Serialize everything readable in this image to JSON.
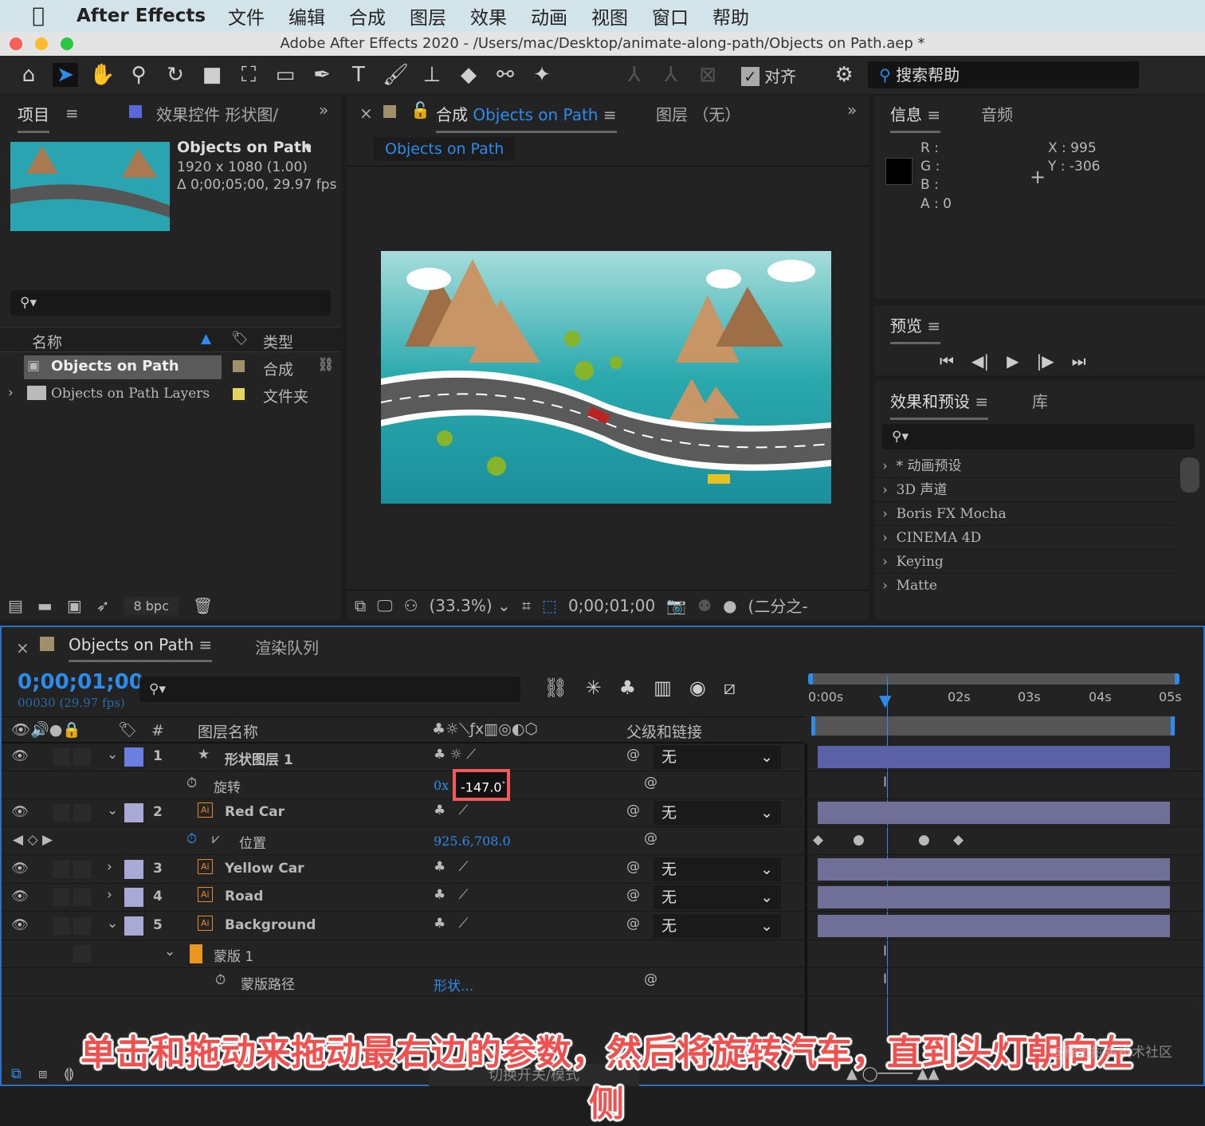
{
  "menubar": {
    "app": "After Effects",
    "items": [
      "文件",
      "编辑",
      "合成",
      "图层",
      "效果",
      "动画",
      "视图",
      "窗口",
      "帮助"
    ]
  },
  "window_title": "Adobe After Effects 2020 - /Users/mac/Desktop/animate-along-path/Objects on Path.aep *",
  "toolbar": {
    "snap_label": "对齐",
    "snap_checked": true,
    "search_help": "搜索帮助"
  },
  "project": {
    "tab": "项目",
    "effects_tab": "效果控件 形状图/",
    "comp_name": "Objects on Path",
    "comp_info1": "1920 x 1080 (1.00)",
    "comp_info2": "Δ 0;00;05;00, 29.97 fps",
    "col_name": "名称",
    "col_type": "类型",
    "items": [
      {
        "name": "Objects on Path",
        "type": "合成",
        "color": "#a0906a"
      },
      {
        "name": "Objects on Path Layers",
        "type": "文件夹",
        "color": "#e3d45a"
      }
    ],
    "bpc": "8 bpc"
  },
  "comp": {
    "tab_prefix": "合成",
    "tab_name": "Objects on Path",
    "layer_tab": "图层 （无）",
    "breadcrumb": "Objects on Path",
    "zoom": "(33.3%)",
    "timecode": "0;00;01;00",
    "resolution": "(二分之-"
  },
  "info": {
    "tab": "信息",
    "audio_tab": "音频",
    "r": "R :",
    "g": "G :",
    "b": "B :",
    "a": "A :  0",
    "x": "X : 995",
    "y": "Y :  -306"
  },
  "preview": {
    "tab": "预览"
  },
  "effects": {
    "tab": "效果和预设",
    "lib_tab": "库",
    "items": [
      "* 动画预设",
      "3D 声道",
      "Boris FX Mocha",
      "CINEMA 4D",
      "Keying",
      "Matte"
    ]
  },
  "timeline": {
    "tab": "Objects on Path",
    "render_tab": "渲染队列",
    "timecode": "0;00;01;00",
    "frames": "00030 (29.97 fps)",
    "col_hash": "#",
    "col_layer": "图层名称",
    "col_parent": "父级和链接",
    "ruler": [
      "0:00s",
      "02s",
      "03s",
      "04s",
      "05s"
    ],
    "toggle_mode": "切换开关/模式",
    "layers": [
      {
        "num": "1",
        "name": "形状图层 1",
        "color": "#6b7fe0",
        "parent": "无"
      },
      {
        "num": "2",
        "name": "Red Car",
        "color": "#a9a9d6",
        "parent": "无"
      },
      {
        "num": "3",
        "name": "Yellow Car",
        "color": "#a9a9d6",
        "parent": "无"
      },
      {
        "num": "4",
        "name": "Road",
        "color": "#a9a9d6",
        "parent": "无"
      },
      {
        "num": "5",
        "name": "Background",
        "color": "#a9a9d6",
        "parent": "无"
      }
    ],
    "rotation": {
      "label": "旋转",
      "revolutions": "0x",
      "degrees": "-147.0",
      "unit": "°"
    },
    "position": {
      "label": "位置",
      "value": "925.6,708.0"
    },
    "mask": {
      "label": "蒙版 1",
      "path_label": "蒙版路径",
      "path_value": "形状..."
    }
  },
  "caption": "单击和拖动来拖动最右边的参数，然后将旋转汽车，直到头灯朝向左侧",
  "watermark": "@稀土掘金技术社区"
}
